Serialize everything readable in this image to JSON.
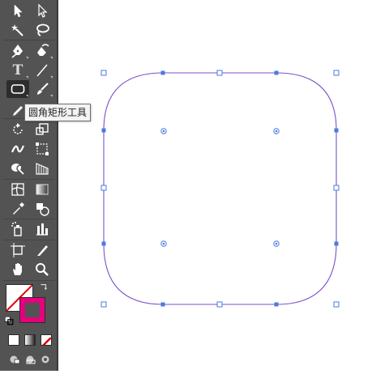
{
  "tooltip": {
    "text": "圆角矩形工具"
  },
  "tools": {
    "type_label": "T"
  },
  "colors": {
    "toolbar_bg": "#535353",
    "stroke_color": "#e6007e",
    "selection_blue": "#4a7be0",
    "shape_stroke": "#7b52c7"
  },
  "icons": [
    "selection-tool-icon",
    "direct-selection-tool-icon",
    "magic-wand-icon",
    "lasso-icon",
    "pen-tool-icon",
    "curvature-pen-icon",
    "type-tool-icon",
    "line-segment-icon",
    "rounded-rectangle-tool-icon",
    "paintbrush-icon",
    "pencil-icon",
    "rotate-icon",
    "scale-icon",
    "width-tool-icon",
    "free-transform-icon",
    "shape-builder-icon",
    "perspective-grid-icon",
    "mesh-icon",
    "gradient-icon",
    "eyedropper-icon",
    "blend-icon",
    "symbol-sprayer-icon",
    "column-graph-icon",
    "artboard-icon",
    "slice-icon",
    "hand-icon",
    "zoom-icon"
  ]
}
